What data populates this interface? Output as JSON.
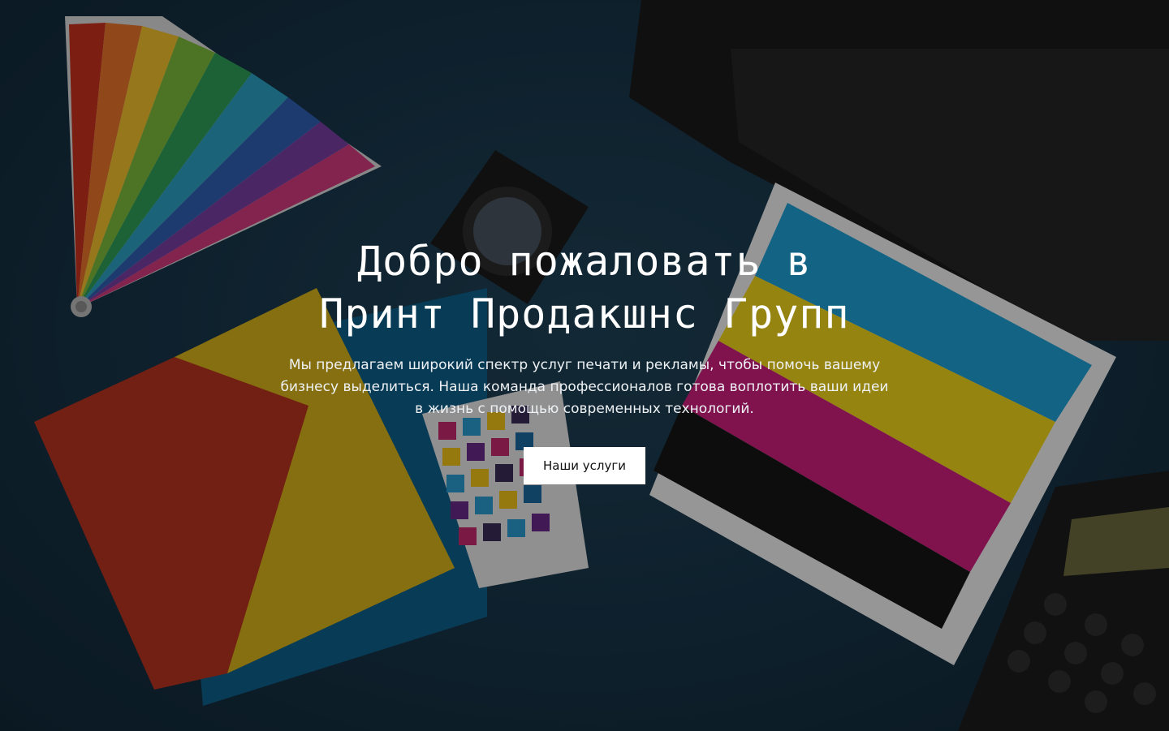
{
  "hero": {
    "title_line1": "Добро пожаловать в",
    "title_line2": "Принт Продакшнс Групп",
    "description": "Мы предлагаем широкий спектр услуг печати и рекламы, чтобы помочь вашему бизнесу выделиться. Наша команда профессионалов готова воплотить ваши идеи в жизнь с помощью современных технологий.",
    "cta_label": "Наши услуги"
  },
  "colors": {
    "overlay": "#000000",
    "background": "#173448",
    "button_bg": "#ffffff",
    "button_text": "#111111",
    "text": "#ffffff"
  }
}
